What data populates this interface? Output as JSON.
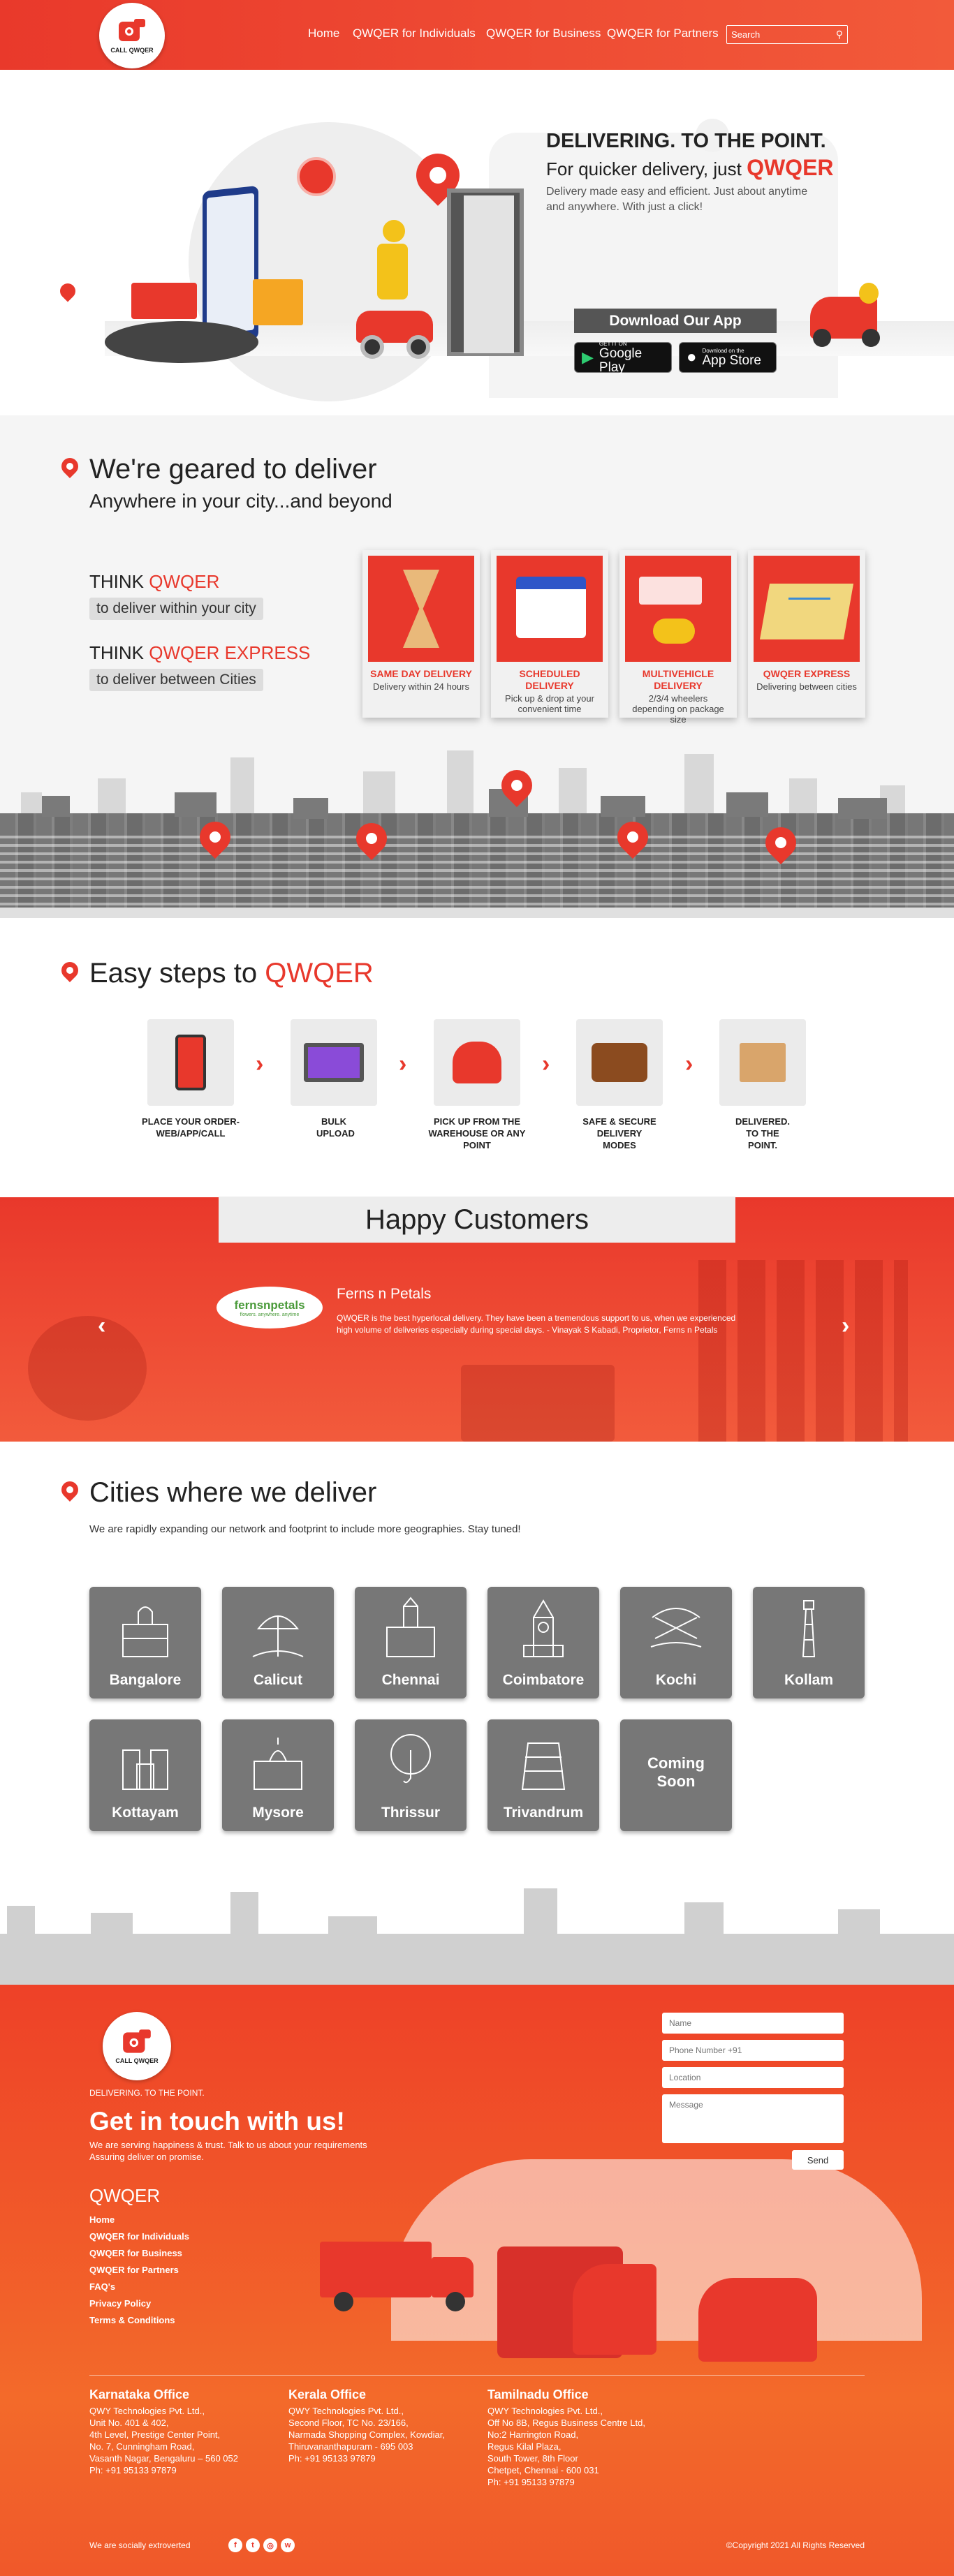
{
  "header": {
    "brand_small": "CALL QWQER",
    "nav": [
      "Home",
      "QWQER for Individuals",
      "QWQER for Business",
      "QWQER for Partners"
    ],
    "search_placeholder": "Search"
  },
  "hero": {
    "headline": "DELIVERING. TO THE POINT.",
    "sub_prefix": "For quicker delivery, just",
    "sub_brand": "QWQER",
    "desc": "Delivery made easy and efficient. Just about anytime and anywhere. With just a click!",
    "download_label": "Download Our App",
    "google": {
      "small": "GET IT ON",
      "large": "Google Play"
    },
    "apple": {
      "small": "Download on the",
      "large": "App Store"
    }
  },
  "geared": {
    "title": "We're geared to deliver",
    "subtitle": "Anywhere in your city...and beyond",
    "think1_prefix": "THINK",
    "think1_brand": "QWQER",
    "think1_desc": "to deliver within your city",
    "think2_prefix": "THINK",
    "think2_brand": "QWQER EXPRESS",
    "think2_desc": "to deliver between Cities",
    "cards": [
      {
        "title": "SAME DAY DELIVERY",
        "desc": "Delivery within 24 hours"
      },
      {
        "title": "SCHEDULED DELIVERY",
        "desc": "Pick up & drop at your convenient time"
      },
      {
        "title": "MULTIVEHICLE DELIVERY",
        "desc": "2/3/4 wheelers depending on package size"
      },
      {
        "title": "QWQER EXPRESS",
        "desc": "Delivering between cities"
      }
    ]
  },
  "steps": {
    "title_prefix": "Easy steps to",
    "title_brand": "QWQER",
    "items": [
      {
        "label": "PLACE YOUR ORDER- WEB/APP/CALL"
      },
      {
        "label": "BULK UPLOAD"
      },
      {
        "label": "PICK UP FROM THE WAREHOUSE OR ANY POINT"
      },
      {
        "label": "SAFE & SECURE DELIVERY MODES"
      },
      {
        "label": "DELIVERED. TO THE POINT."
      }
    ]
  },
  "customers": {
    "title": "Happy Customers",
    "logo_text": "fernsnpetals",
    "logo_tag": "flowers. anywhere. anytime",
    "name": "Ferns n Petals",
    "quote": "QWQER is the best hyperlocal delivery. They have been a tremendous support to us, when we experienced high volume of deliveries especially during special days. - Vinayak S Kabadi, Proprietor, Ferns n Petals"
  },
  "cities": {
    "title": "Cities where we deliver",
    "desc": "We are rapidly expanding our network and footprint to include more geographies. Stay tuned!",
    "items": [
      "Bangalore",
      "Calicut",
      "Chennai",
      "Coimbatore",
      "Kochi",
      "Kollam",
      "Kottayam",
      "Mysore",
      "Thrissur",
      "Trivandrum",
      "Coming Soon"
    ]
  },
  "footer": {
    "tagline": "DELIVERING. TO THE POINT.",
    "heading": "Get in touch with us!",
    "line1": "We are serving happiness & trust. Talk to us about your requirements",
    "line2": "Assuring deliver on promise.",
    "brand": "QWQER",
    "links": [
      "Home",
      "QWQER for Individuals",
      "QWQER for Business",
      "QWQER for Partners",
      "FAQ's",
      "Privacy Policy",
      "Terms & Conditions"
    ],
    "form": {
      "name": "Name",
      "phone": "Phone Number +91",
      "location": "Location",
      "message": "Message",
      "send": "Send"
    },
    "offices": [
      {
        "title": "Karnataka Office",
        "lines": [
          "QWY Technologies Pvt. Ltd.,",
          "Unit No. 401 & 402,",
          "4th Level, Prestige Center Point,",
          "No. 7, Cunningham Road,",
          "Vasanth Nagar, Bengaluru – 560 052",
          "Ph: +91 95133 97879"
        ]
      },
      {
        "title": "Kerala Office",
        "lines": [
          "QWY Technologies Pvt. Ltd.,",
          "Second Floor, TC No. 23/166,",
          "Narmada Shopping Complex, Kowdiar,",
          "Thiruvananthapuram - 695 003",
          "Ph: +91 95133 97879"
        ]
      },
      {
        "title": "Tamilnadu Office",
        "lines": [
          "QWY Technologies Pvt. Ltd.,",
          "Off No 8B, Regus Business Centre Ltd,",
          "No:2 Harrington Road,",
          "Regus Kilal Plaza,",
          "South Tower, 8th Floor",
          "Chetpet, Chennai - 600 031",
          "Ph: +91 95133 97879"
        ]
      }
    ],
    "social_label": "We are socially extroverted",
    "copyright": "©Copyright 2021 All Rights Reserved"
  },
  "colors": {
    "brand_red": "#e8382c",
    "grey": "#777777"
  }
}
